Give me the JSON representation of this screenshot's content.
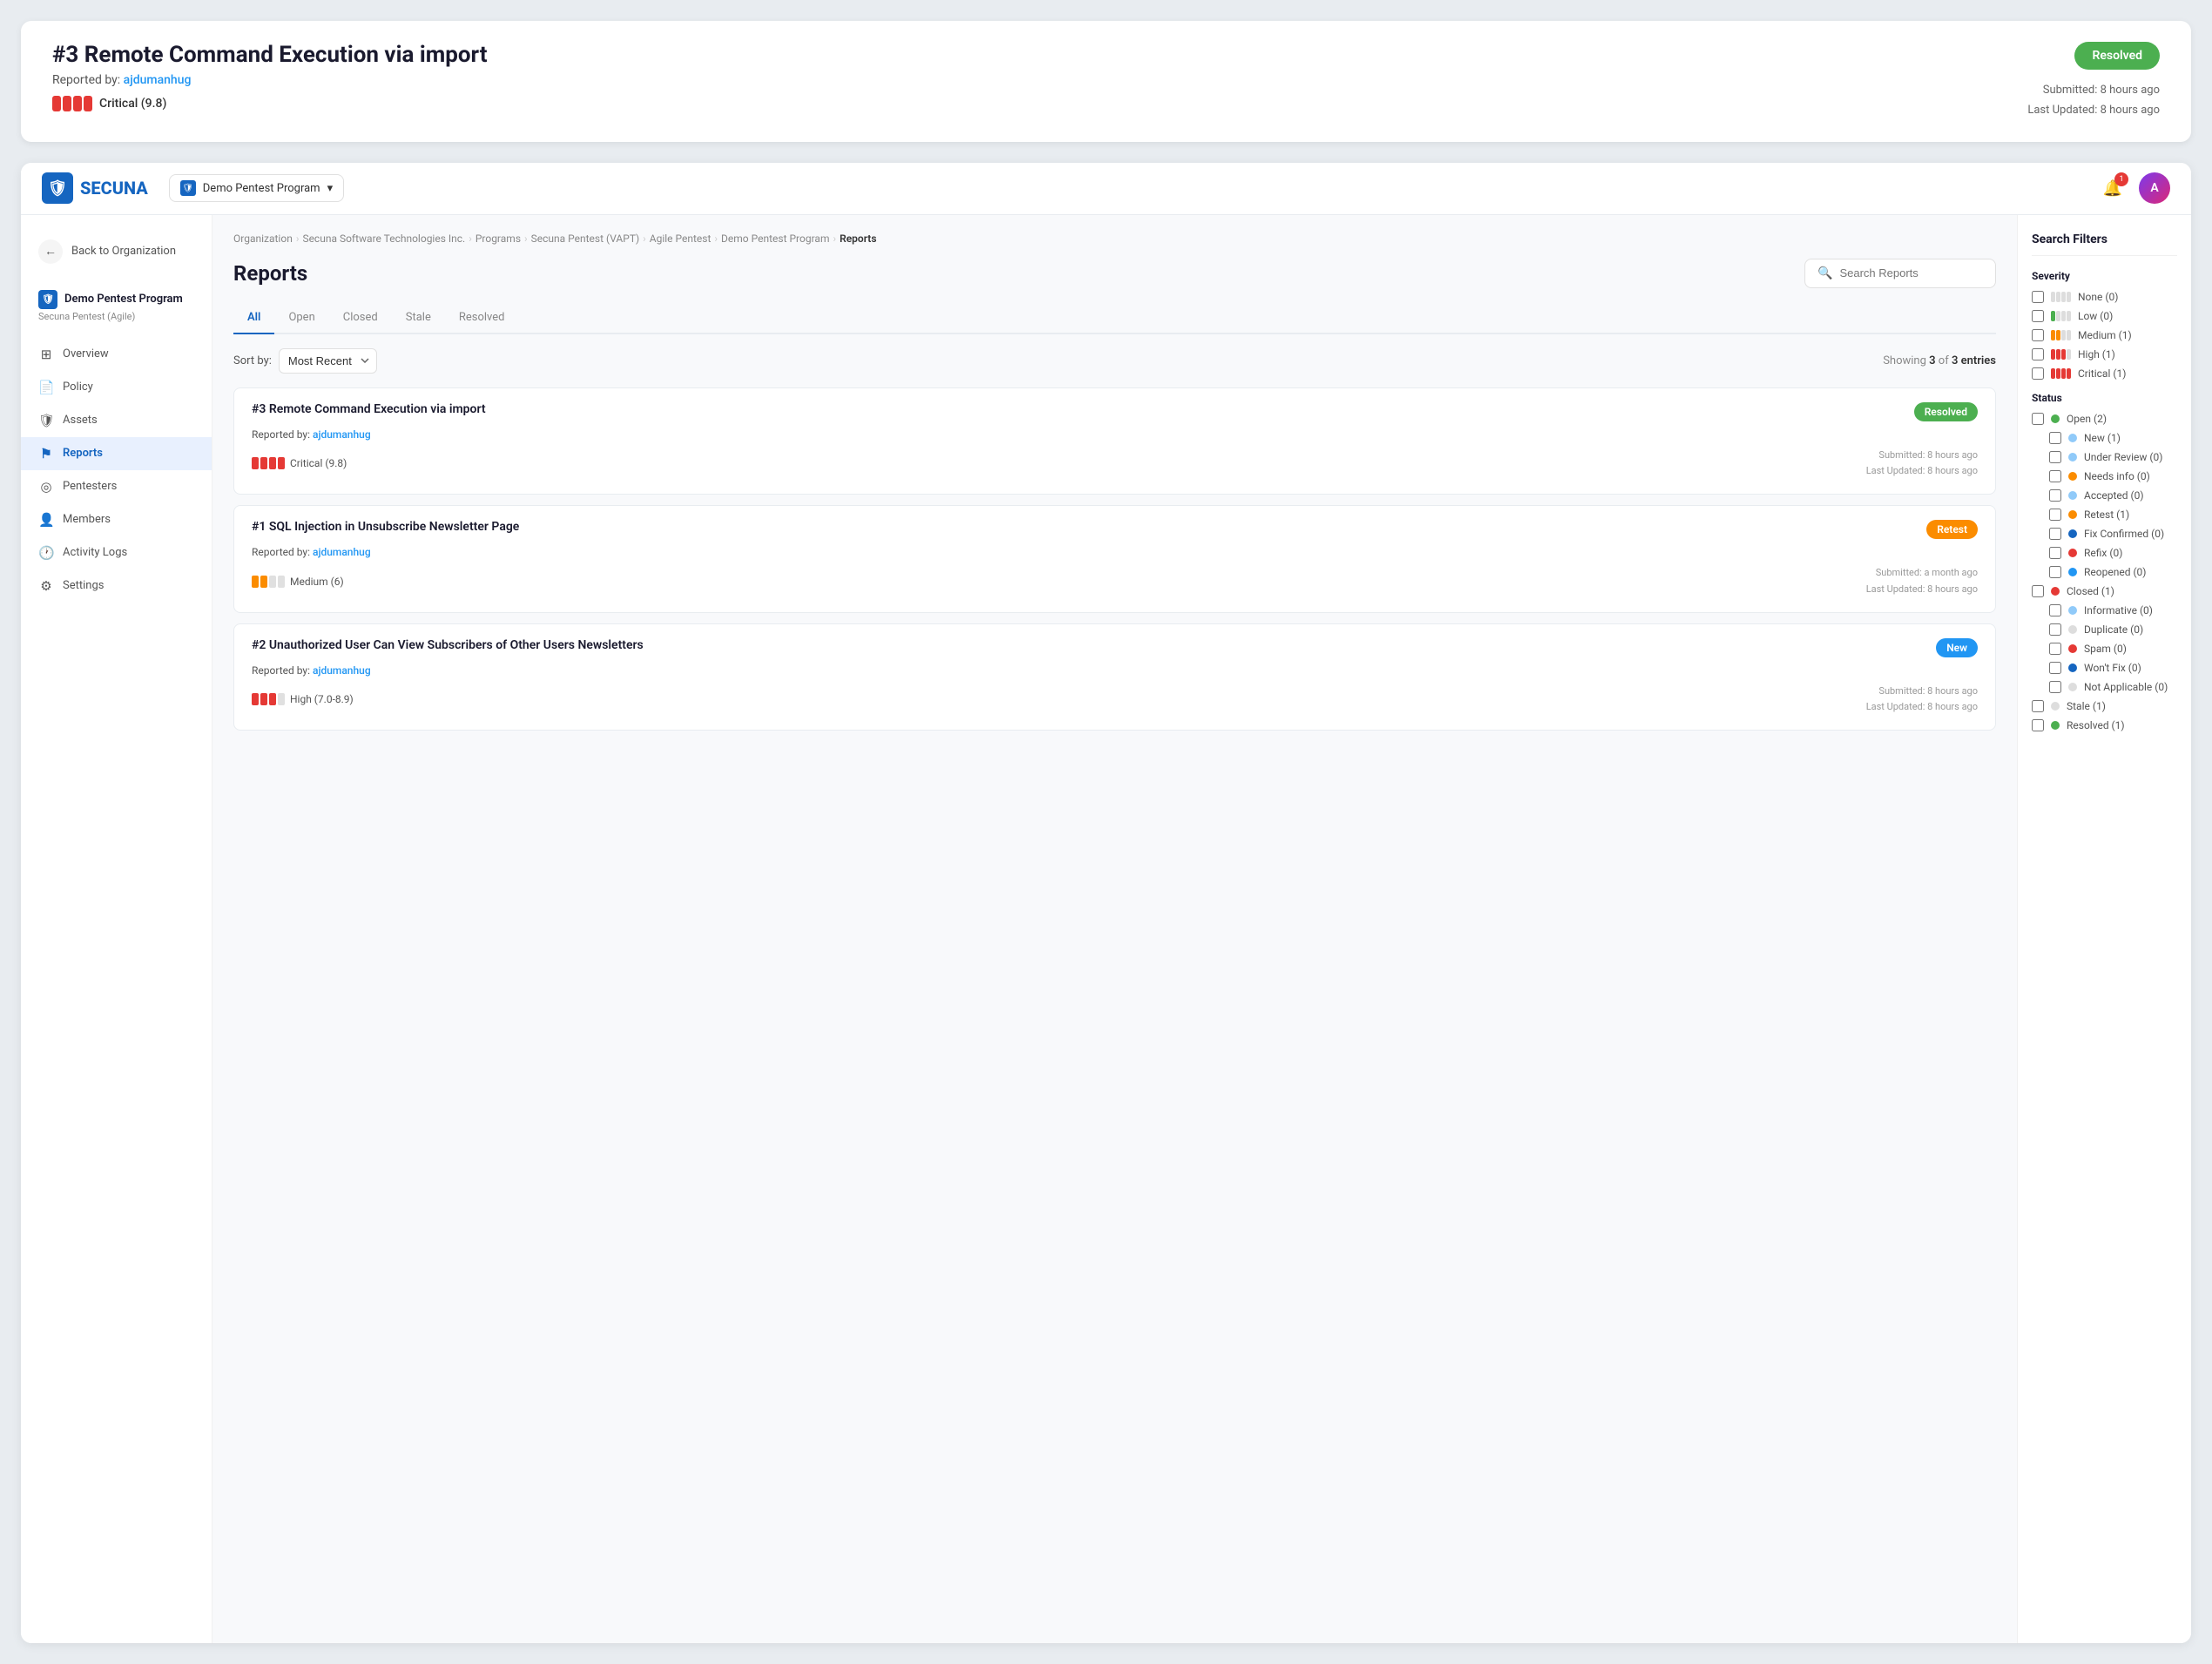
{
  "topCard": {
    "title": "#3 Remote Command Execution via import",
    "reportedBy": "ajdumanhug",
    "status": "Resolved",
    "severity": "Critical (9.8)",
    "submitted": "Submitted: 8 hours ago",
    "lastUpdated": "Last Updated: 8 hours ago"
  },
  "navbar": {
    "logo": "SECUNA",
    "programName": "Demo Pentest Program",
    "notifCount": "1"
  },
  "sidebar": {
    "backLabel": "Back to Organization",
    "programName": "Demo Pentest Program",
    "programSub": "Secuna Pentest (Agile)",
    "nav": [
      {
        "label": "Overview",
        "icon": "⊞",
        "active": false
      },
      {
        "label": "Policy",
        "icon": "📄",
        "active": false
      },
      {
        "label": "Assets",
        "icon": "🛡",
        "active": false
      },
      {
        "label": "Reports",
        "icon": "⚑",
        "active": true
      },
      {
        "label": "Pentesters",
        "icon": "◎",
        "active": false
      },
      {
        "label": "Members",
        "icon": "👤",
        "active": false
      },
      {
        "label": "Activity Logs",
        "icon": "🕐",
        "active": false
      },
      {
        "label": "Settings",
        "icon": "⚙",
        "active": false
      }
    ]
  },
  "breadcrumb": {
    "items": [
      "Organization",
      "Secuna Software Technologies Inc.",
      "Programs",
      "Secuna Pentest (VAPT)",
      "Agile Pentest",
      "Demo Pentest Program",
      "Reports"
    ]
  },
  "page": {
    "title": "Reports",
    "searchPlaceholder": "Search Reports",
    "tabs": [
      "All",
      "Open",
      "Closed",
      "Stale",
      "Resolved"
    ],
    "activeTab": "All",
    "sortLabel": "Sort by:",
    "sortValue": "Most Recent",
    "showingText": "Showing",
    "showingCount": "3",
    "showingOf": "of",
    "showingTotal": "3 entries"
  },
  "reports": [
    {
      "title": "#3 Remote Command Execution via import",
      "reporter": "ajdumanhug",
      "status": "Resolved",
      "statusClass": "status-resolved",
      "severity": "Critical (9.8)",
      "severityType": "critical",
      "submitted": "Submitted: 8 hours ago",
      "lastUpdated": "Last Updated: 8 hours ago"
    },
    {
      "title": "#1 SQL Injection in Unsubscribe Newsletter Page",
      "reporter": "ajdumanhug",
      "status": "Retest",
      "statusClass": "status-retest",
      "severity": "Medium (6)",
      "severityType": "medium",
      "submitted": "Submitted: a month ago",
      "lastUpdated": "Last Updated: 8 hours ago"
    },
    {
      "title": "#2 Unauthorized User Can View Subscribers of Other Users Newsletters",
      "reporter": "ajdumanhug",
      "status": "New",
      "statusClass": "status-new",
      "severity": "High (7.0-8.9)",
      "severityType": "high",
      "submitted": "Submitted: 8 hours ago",
      "lastUpdated": "Last Updated: 8 hours ago"
    }
  ],
  "filters": {
    "title": "Search Filters",
    "severityTitle": "Severity",
    "severityItems": [
      {
        "label": "None (0)",
        "type": "none"
      },
      {
        "label": "Low (0)",
        "type": "low"
      },
      {
        "label": "Medium (1)",
        "type": "medium"
      },
      {
        "label": "High (1)",
        "type": "high"
      },
      {
        "label": "Critical (1)",
        "type": "critical"
      }
    ],
    "statusTitle": "Status",
    "statusItems": [
      {
        "label": "Open (2)",
        "dotColor": "#4caf50",
        "indent": false
      },
      {
        "label": "New (1)",
        "dotColor": "#90caf9",
        "indent": true
      },
      {
        "label": "Under Review (0)",
        "dotColor": "#90caf9",
        "indent": true
      },
      {
        "label": "Needs info (0)",
        "dotColor": "#fb8c00",
        "indent": true
      },
      {
        "label": "Accepted (0)",
        "dotColor": "#90caf9",
        "indent": true
      },
      {
        "label": "Retest (1)",
        "dotColor": "#fb8c00",
        "indent": true
      },
      {
        "label": "Fix Confirmed (0)",
        "dotColor": "#1565c0",
        "indent": true
      },
      {
        "label": "Refix (0)",
        "dotColor": "#e53935",
        "indent": true
      },
      {
        "label": "Reopened (0)",
        "dotColor": "#2196F3",
        "indent": true
      },
      {
        "label": "Closed (1)",
        "dotColor": "#e53935",
        "indent": false
      },
      {
        "label": "Informative (0)",
        "dotColor": "#90caf9",
        "indent": true
      },
      {
        "label": "Duplicate (0)",
        "dotColor": "#ddd",
        "indent": true
      },
      {
        "label": "Spam (0)",
        "dotColor": "#e53935",
        "indent": true
      },
      {
        "label": "Won't Fix (0)",
        "dotColor": "#1565c0",
        "indent": true
      },
      {
        "label": "Not Applicable (0)",
        "dotColor": "#ddd",
        "indent": true
      },
      {
        "label": "Stale (1)",
        "dotColor": "#ddd",
        "indent": false
      },
      {
        "label": "Resolved (1)",
        "dotColor": "#4caf50",
        "indent": false
      }
    ]
  }
}
